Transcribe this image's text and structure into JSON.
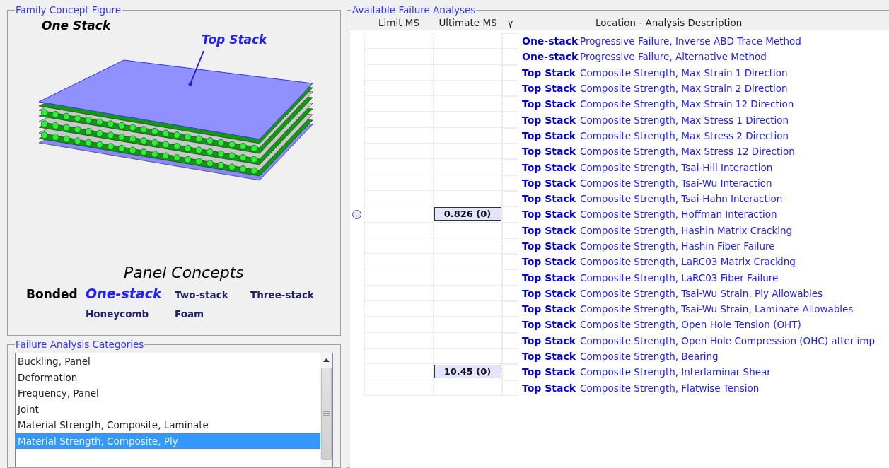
{
  "figure_group": {
    "title": "Family Concept Figure",
    "stack_label": "One Stack",
    "callout": "Top Stack",
    "panel_concepts": {
      "title": "Panel Concepts",
      "group_label": "Bonded",
      "options": [
        {
          "label": "One-stack",
          "selected": true
        },
        {
          "label": "Two-stack",
          "selected": false
        },
        {
          "label": "Three-stack",
          "selected": false
        },
        {
          "label": "Honeycomb",
          "selected": false
        },
        {
          "label": "Foam",
          "selected": false
        }
      ]
    }
  },
  "categories_group": {
    "title": "Failure Analysis Categories",
    "items": [
      {
        "label": "Buckling, Panel",
        "selected": false
      },
      {
        "label": "Deformation",
        "selected": false
      },
      {
        "label": "Frequency, Panel",
        "selected": false
      },
      {
        "label": "Joint",
        "selected": false
      },
      {
        "label": "Material Strength, Composite, Laminate",
        "selected": false
      },
      {
        "label": "Material Strength, Composite, Ply",
        "selected": true
      }
    ]
  },
  "analyses_group": {
    "title": "Available Failure Analyses",
    "columns": [
      "Limit MS",
      "Ultimate MS",
      "γ",
      "Location - Analysis Description"
    ],
    "rows": [
      {
        "radio": false,
        "ultimate": "",
        "location": "One-stack",
        "description": "Progressive Failure, Inverse ABD Trace Method"
      },
      {
        "radio": false,
        "ultimate": "",
        "location": "One-stack",
        "description": "Progressive Failure, Alternative Method"
      },
      {
        "radio": false,
        "ultimate": "",
        "location": "Top Stack",
        "description": "Composite Strength, Max Strain 1 Direction"
      },
      {
        "radio": false,
        "ultimate": "",
        "location": "Top Stack",
        "description": "Composite Strength, Max Strain 2 Direction"
      },
      {
        "radio": false,
        "ultimate": "",
        "location": "Top Stack",
        "description": "Composite Strength, Max Strain 12 Direction"
      },
      {
        "radio": false,
        "ultimate": "",
        "location": "Top Stack",
        "description": "Composite Strength, Max Stress 1 Direction"
      },
      {
        "radio": false,
        "ultimate": "",
        "location": "Top Stack",
        "description": "Composite Strength, Max Stress 2 Direction"
      },
      {
        "radio": false,
        "ultimate": "",
        "location": "Top Stack",
        "description": "Composite Strength, Max Stress 12 Direction"
      },
      {
        "radio": false,
        "ultimate": "",
        "location": "Top Stack",
        "description": "Composite Strength, Tsai-Hill Interaction"
      },
      {
        "radio": false,
        "ultimate": "",
        "location": "Top Stack",
        "description": "Composite Strength, Tsai-Wu Interaction"
      },
      {
        "radio": false,
        "ultimate": "",
        "location": "Top Stack",
        "description": "Composite Strength, Tsai-Hahn Interaction"
      },
      {
        "radio": true,
        "ultimate": "0.826 (0)",
        "location": "Top Stack",
        "description": "Composite Strength, Hoffman Interaction"
      },
      {
        "radio": false,
        "ultimate": "",
        "location": "Top Stack",
        "description": "Composite Strength, Hashin Matrix Cracking"
      },
      {
        "radio": false,
        "ultimate": "",
        "location": "Top Stack",
        "description": "Composite Strength, Hashin Fiber Failure"
      },
      {
        "radio": false,
        "ultimate": "",
        "location": "Top Stack",
        "description": "Composite Strength, LaRC03 Matrix Cracking"
      },
      {
        "radio": false,
        "ultimate": "",
        "location": "Top Stack",
        "description": "Composite Strength, LaRC03 Fiber Failure"
      },
      {
        "radio": false,
        "ultimate": "",
        "location": "Top Stack",
        "description": "Composite Strength, Tsai-Wu Strain, Ply Allowables"
      },
      {
        "radio": false,
        "ultimate": "",
        "location": "Top Stack",
        "description": "Composite Strength, Tsai-Wu Strain, Laminate Allowables"
      },
      {
        "radio": false,
        "ultimate": "",
        "location": "Top Stack",
        "description": "Composite Strength, Open Hole Tension (OHT)"
      },
      {
        "radio": false,
        "ultimate": "",
        "location": "Top Stack",
        "description": "Composite Strength, Open Hole Compression (OHC) after imp"
      },
      {
        "radio": false,
        "ultimate": "",
        "location": "Top Stack",
        "description": "Composite Strength, Bearing"
      },
      {
        "radio": false,
        "ultimate": "10.45 (0)",
        "location": "Top Stack",
        "description": "Composite Strength, Interlaminar Shear"
      },
      {
        "radio": false,
        "ultimate": "",
        "location": "Top Stack",
        "description": "Composite Strength, Flatwise Tension"
      }
    ]
  }
}
